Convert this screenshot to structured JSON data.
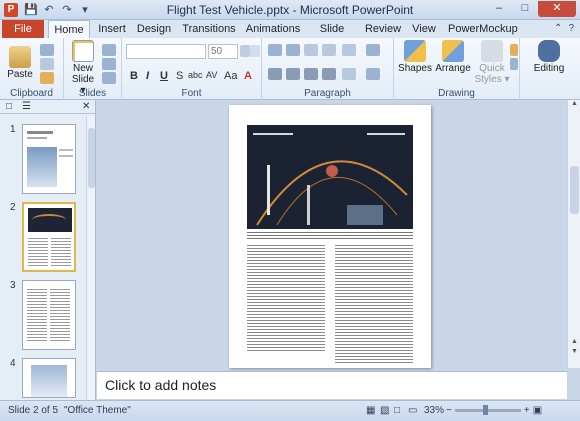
{
  "window": {
    "title": "Flight Test Vehicle.pptx - Microsoft PowerPoint",
    "app_letter": "P"
  },
  "tabs": {
    "file": "File",
    "items": [
      "Home",
      "Insert",
      "Design",
      "Transitions",
      "Animations",
      "Slide Show",
      "Review",
      "View",
      "PowerMockup"
    ]
  },
  "ribbon": {
    "clipboard": {
      "label": "Clipboard",
      "paste": "Paste"
    },
    "slides": {
      "label": "Slides",
      "new_slide": "New",
      "new_slide2": "Slide ▾"
    },
    "font": {
      "label": "Font",
      "size_value": "50",
      "bold": "B",
      "italic": "I",
      "underline": "U",
      "strike": "S",
      "abc": "abc",
      "av": "AV",
      "aa": "Aa",
      "a_color": "A"
    },
    "paragraph": {
      "label": "Paragraph"
    },
    "drawing": {
      "label": "Drawing",
      "shapes": "Shapes",
      "arrange": "Arrange",
      "quick_styles": "Quick",
      "quick_styles2": "Styles ▾"
    },
    "editing": {
      "label": "Editing"
    }
  },
  "slides_pane": {
    "close": "✕",
    "thumbs": [
      {
        "number": "1",
        "selected": false
      },
      {
        "number": "2",
        "selected": true
      },
      {
        "number": "3",
        "selected": false
      },
      {
        "number": "4",
        "selected": false
      }
    ]
  },
  "notes": {
    "placeholder": "Click to add notes"
  },
  "status": {
    "slide": "Slide 2 of 5",
    "theme": "\"Office Theme\"",
    "zoom": "33%"
  },
  "colors": {
    "file_tab": "#c8452b",
    "accent": "#e3b64d"
  }
}
